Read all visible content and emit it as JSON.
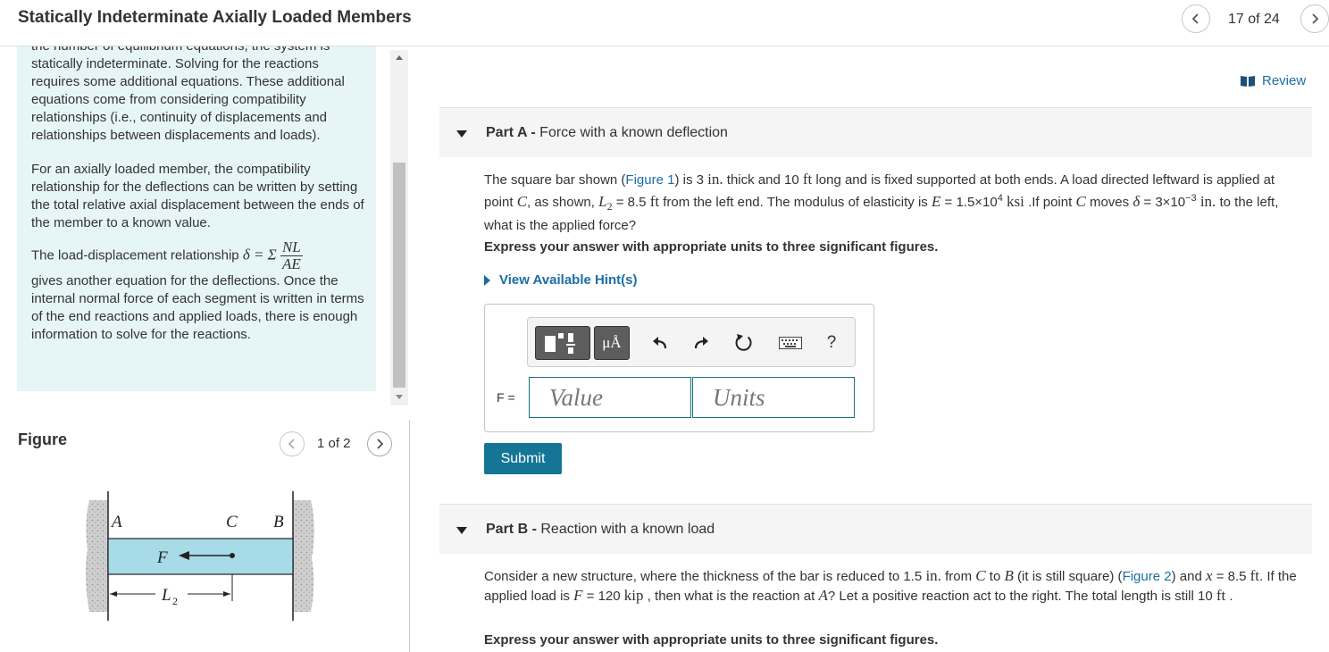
{
  "header": {
    "title": "Statically Indeterminate Axially Loaded Members",
    "counter": "17 of 24"
  },
  "intro": {
    "p1_cut": "the number of equilibrium equations, the system is",
    "p1": "statically indeterminate. Solving for the reactions requires some additional equations. These additional equations come from considering compatibility relationships (i.e., continuity of displacements and relationships between displacements and loads).",
    "p2": "For an axially loaded member, the compatibility relationship for the deflections can be written by setting the total relative axial displacement between the ends of the member to a known value.",
    "p3_pre": "The load-displacement relationship",
    "p3_delta": "δ = Σ",
    "p3_num": "NL",
    "p3_den": "AE",
    "p3_post": "gives another equation for the deflections. Once the internal normal force of each segment is written in terms of the end reactions and applied loads, there is enough information to solve for the reactions."
  },
  "figure": {
    "label": "Figure",
    "counter": "1 of 2",
    "labels": {
      "A": "A",
      "C": "C",
      "B": "B",
      "F": "F",
      "L2": "L",
      "L2_sub": "2"
    }
  },
  "review": {
    "label": "Review"
  },
  "partA": {
    "part": "Part A -",
    "title": "Force with a known deflection",
    "q1": "The square bar shown (",
    "fig_link": "Figure 1",
    "q2": ") is 3",
    "in": "in.",
    "q3": "thick and 10",
    "ft": "ft",
    "q4": "long and is fixed supported at both ends. A load directed leftward is applied at point",
    "C": "C",
    "q5": ", as shown,",
    "L2": "L",
    "L2sub": "2",
    "q6": "= 8.5",
    "q7": "from the left end. The modulus of elasticity is",
    "E": "E",
    "q8": "= 1.5×10",
    "exp4": "4",
    "ksi": "ksi",
    "q9": ".If point",
    "q10": "moves",
    "delta": "δ",
    "q11": "= 3×10",
    "expm3": "−3",
    "q12": "to the left, what is the applied force?",
    "instruction": "Express your answer with appropriate units to three significant figures.",
    "hints": "View Available Hint(s)",
    "f_label": "F =",
    "value_placeholder": "Value",
    "units_placeholder": "Units",
    "units_btn": "μÅ",
    "help": "?",
    "submit": "Submit"
  },
  "partB": {
    "part": "Part B -",
    "title": "Reaction with a known load",
    "q1": "Consider a new structure, where the thickness of the bar is reduced to 1.5",
    "in": "in.",
    "q2": "from",
    "C": "C",
    "q3": "to",
    "B": "B",
    "q4": "(it is still square) (",
    "fig_link": "Figure 2",
    "q5": ") and",
    "x": "x",
    "q6": "= 8.5",
    "ft": "ft",
    "q7": ". If the applied load is",
    "F": "F",
    "q8": "= 120",
    "kip": "kip",
    "q9": ", then what is the reaction at",
    "A": "A",
    "q10": "? Let a positive reaction act to the right. The total length is still 10",
    "q11": ".",
    "instruction": "Express your answer with appropriate units to three significant figures."
  },
  "colors": {
    "accent": "#1a6ea5",
    "intro_bg": "#e6f6f6",
    "submit": "#157595",
    "bar_fill": "#a7dbe8"
  },
  "icons": [
    "chevron-left-icon",
    "chevron-right-icon",
    "book-icon",
    "templates-icon",
    "undo-icon",
    "redo-icon",
    "reset-icon",
    "keyboard-icon"
  ]
}
